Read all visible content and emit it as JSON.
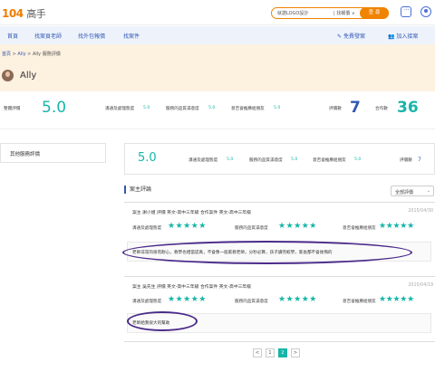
{
  "header": {
    "logo_num": "104",
    "logo_text": "高手",
    "search_query": "就諾LOGO設計",
    "search_scope": "| 找報價 ∨",
    "search_button": "查 尋",
    "chat_icon": "chat-icon",
    "user_icon": "user-icon"
  },
  "nav": {
    "items": [
      "首頁",
      "找案頁老師",
      "找外包報價",
      "找案件"
    ],
    "free_post": "免費發案",
    "join": "加入接案"
  },
  "breadcrumb": {
    "home": "首頁",
    "sep1": ">",
    "name": "Ally",
    "sep2": ">",
    "current": "Ally 服務評價"
  },
  "profile": {
    "name": "Ally"
  },
  "summary": {
    "overall_label": "整體評價",
    "overall_score": "5.0",
    "metrics": [
      {
        "label": "溝通及處理態度",
        "value": "5.0"
      },
      {
        "label": "服務的品質滿意度",
        "value": "5.0"
      },
      {
        "label": "意否會推薦給朋友",
        "value": "5.0"
      }
    ],
    "review_count_label": "評價數",
    "review_count": "7",
    "cooperation_label": "合作數",
    "cooperation_count": "36"
  },
  "sidebar": {
    "item": "其他服務評價"
  },
  "scorebar": {
    "score": "5.0",
    "metrics": [
      {
        "label": "溝通及處理態度",
        "value": "5.0"
      },
      {
        "label": "服務的品質滿意度",
        "value": "5.0"
      },
      {
        "label": "意否會推薦給朋友",
        "value": "5.0"
      }
    ],
    "count_label": "評價數",
    "count": "7"
  },
  "section": {
    "title": "案主評論",
    "filter": "全部評價",
    "filter_icon": "chevron-down-icon"
  },
  "reviews": [
    {
      "head": "案主 謝小姐   評價 英文-高中三年級  合作案件 英文-高中三年級",
      "date": "2015/04/30",
      "labels": [
        "溝通及處理態度",
        "服務的品質滿意度",
        "意否會推薦給朋友"
      ],
      "stars": 5,
      "comment": "老師非常的很有耐心，教學也相當認真，不會像一般家教老師，分秒必算，孩子讀完較學，家長都不會後悔的"
    },
    {
      "head": "案主 吳先生   評價 英文-高中三年級  合作案件 英文-高中三年級",
      "date": "2015/04/19",
      "labels": [
        "溝通及處理態度",
        "服務的品質滿意度",
        "意否會推薦給朋友"
      ],
      "stars": 5,
      "comment": "老師給我很大的幫助"
    }
  ],
  "pagination": {
    "prev": "<",
    "pages": [
      "1",
      "2"
    ],
    "active": "2",
    "next": ">"
  },
  "colors": {
    "accent": "#17b5a8",
    "brand": "#f08300",
    "link": "#3358b5",
    "banner": "#fdf1e0",
    "annotation": "#4a2a8a"
  }
}
